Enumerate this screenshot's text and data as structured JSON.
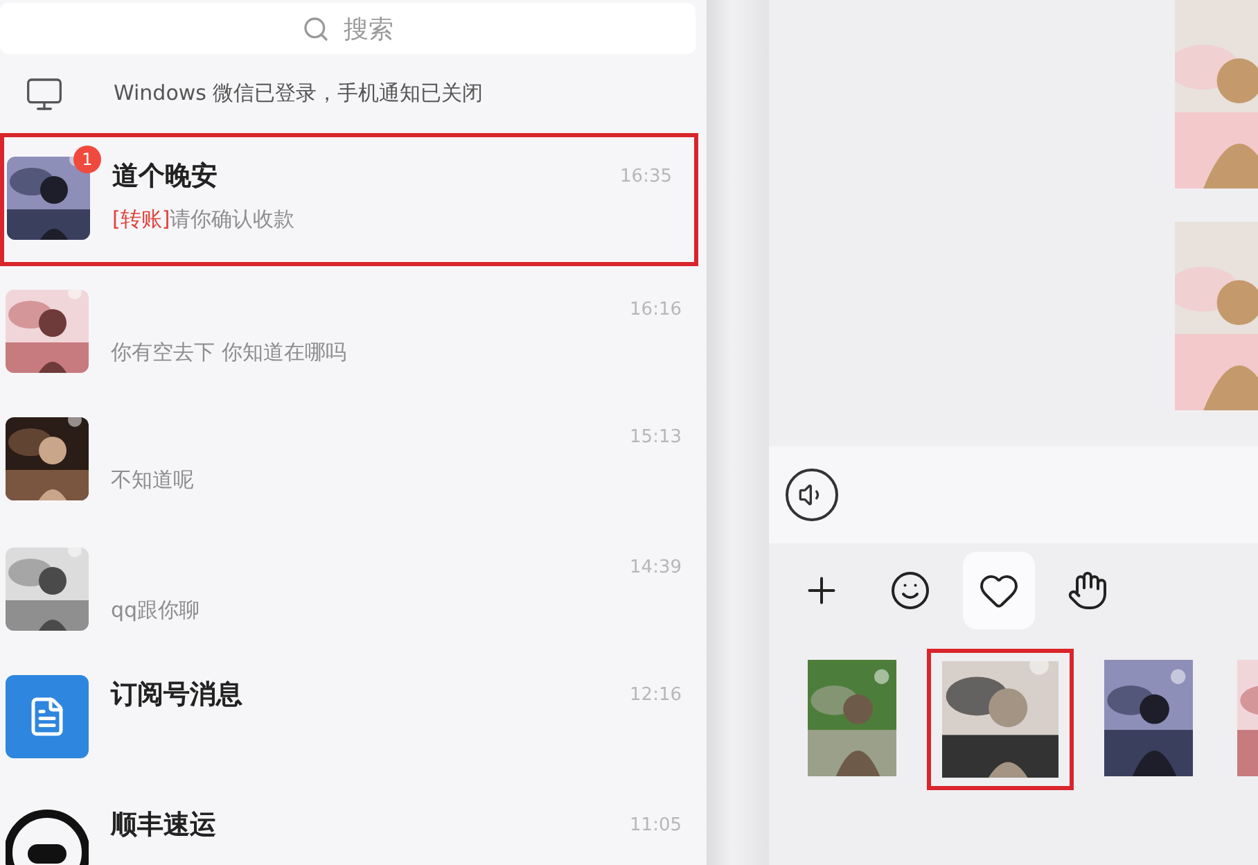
{
  "search": {
    "placeholder": "搜索"
  },
  "notice": {
    "text": "Windows 微信已登录，手机通知已关闭"
  },
  "chats": [
    {
      "kind": "picture",
      "name": "道个晚安",
      "preview": "**[转账]**请你确认收款",
      "time": "16:35",
      "badge": "1",
      "highlighted": true
    },
    {
      "kind": "picture",
      "preview": "你有空去下  你知道在哪吗",
      "time": "16:16",
      "highlighted": false
    },
    {
      "kind": "picture",
      "preview": "不知道呢",
      "time": "15:13",
      "highlighted": false
    },
    {
      "kind": "picture",
      "preview": "qq跟你聊",
      "time": "14:39",
      "highlighted": false
    },
    {
      "kind": "subscription",
      "name": "订阅号消息",
      "time": "12:16",
      "highlighted": false
    },
    {
      "kind": "logo",
      "name": "顺丰速运",
      "time": "11:05",
      "highlighted": false
    }
  ],
  "messages": [
    {
      "kind": "picture"
    },
    {
      "kind": "picture"
    }
  ],
  "composer": {
    "tools": [
      {
        "kind": "plus",
        "selected": false
      },
      {
        "kind": "emoji",
        "selected": false
      },
      {
        "kind": "favorite",
        "selected": true
      },
      {
        "kind": "gesture",
        "selected": false
      }
    ]
  },
  "stickers": [
    {
      "kind": "picture",
      "highlighted": false
    },
    {
      "kind": "picture",
      "highlighted": true
    },
    {
      "kind": "picture",
      "highlighted": false
    },
    {
      "kind": "picture",
      "highlighted": false
    }
  ]
}
